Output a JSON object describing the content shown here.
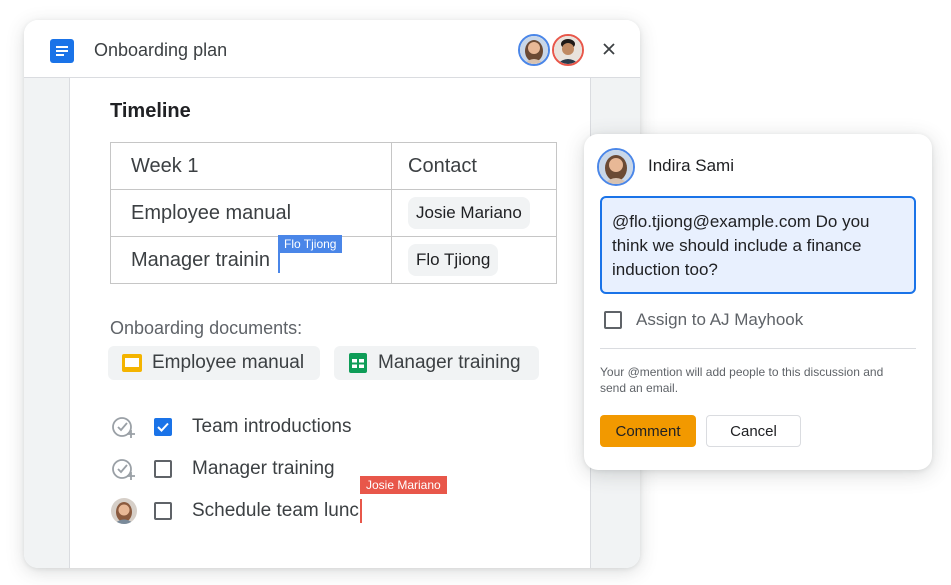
{
  "doc": {
    "title": "Onboarding plan",
    "heading": "Timeline",
    "table": {
      "header": [
        "Week 1",
        "Contact"
      ],
      "rows": [
        {
          "item": "Employee manual",
          "contact": "Josie Mariano"
        },
        {
          "item": "Manager trainin",
          "contact": "Flo Tjiong"
        }
      ]
    },
    "cursor_flo": "Flo Tjiong",
    "cursor_josie": "Josie Mariano",
    "documents_label": "Onboarding documents:",
    "documents": [
      {
        "label": "Employee manual",
        "icon": "slides-icon",
        "color": "#f4b400"
      },
      {
        "label": "Manager training",
        "icon": "sheets-icon",
        "color": "#0f9d58"
      }
    ],
    "tasks": [
      {
        "label": "Team introductions",
        "checked": true
      },
      {
        "label": "Manager training",
        "checked": false
      },
      {
        "label": "Schedule team lunc",
        "checked": false
      }
    ]
  },
  "comment": {
    "author": "Indira Sami",
    "text": "@flo.tjiong@example.com Do you think we should include a finance induction too?",
    "assign_label": "Assign to AJ Mayhook",
    "note": "Your @mention will add people to this discussion and send an email.",
    "comment_button": "Comment",
    "cancel_button": "Cancel"
  },
  "colors": {
    "accent_blue": "#1a73e8",
    "comment_orange": "#f29900",
    "flo_cursor": "#4a86e8",
    "josie_cursor": "#e8574a"
  }
}
